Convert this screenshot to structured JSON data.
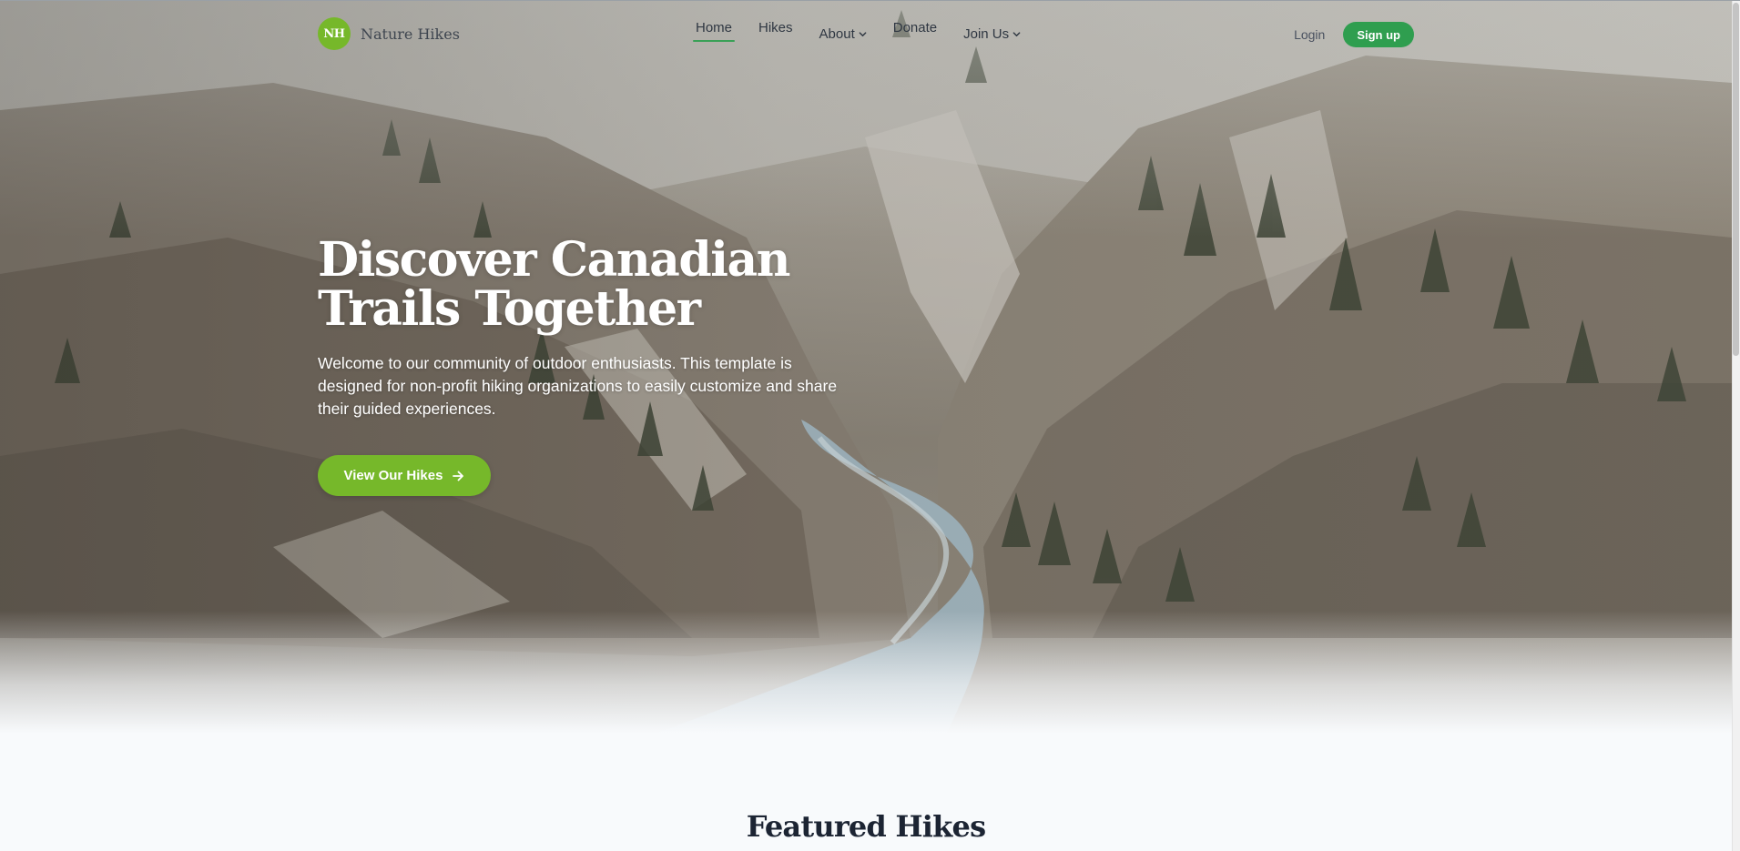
{
  "brand": {
    "badge": "NH",
    "name": "Nature Hikes",
    "color": "#76b82a"
  },
  "nav": {
    "items": [
      {
        "label": "Home",
        "active": true
      },
      {
        "label": "Hikes"
      },
      {
        "label": "About",
        "dropdown": true
      },
      {
        "label": "Donate"
      },
      {
        "label": "Join Us",
        "dropdown": true
      }
    ],
    "login_label": "Login",
    "signup_label": "Sign up",
    "signup_color": "#2f9e4f"
  },
  "hero": {
    "title": "Discover Canadian Trails Together",
    "subtitle": "Welcome to our community of outdoor enthusiasts. This template is designed for non-profit hiking organizations to easily customize and share their guided experiences.",
    "cta_label": "View Our Hikes",
    "cta_icon": "arrow-right-icon",
    "cta_color": "#76b82a",
    "background": "canyon-river-photo"
  },
  "featured": {
    "title": "Featured Hikes"
  }
}
